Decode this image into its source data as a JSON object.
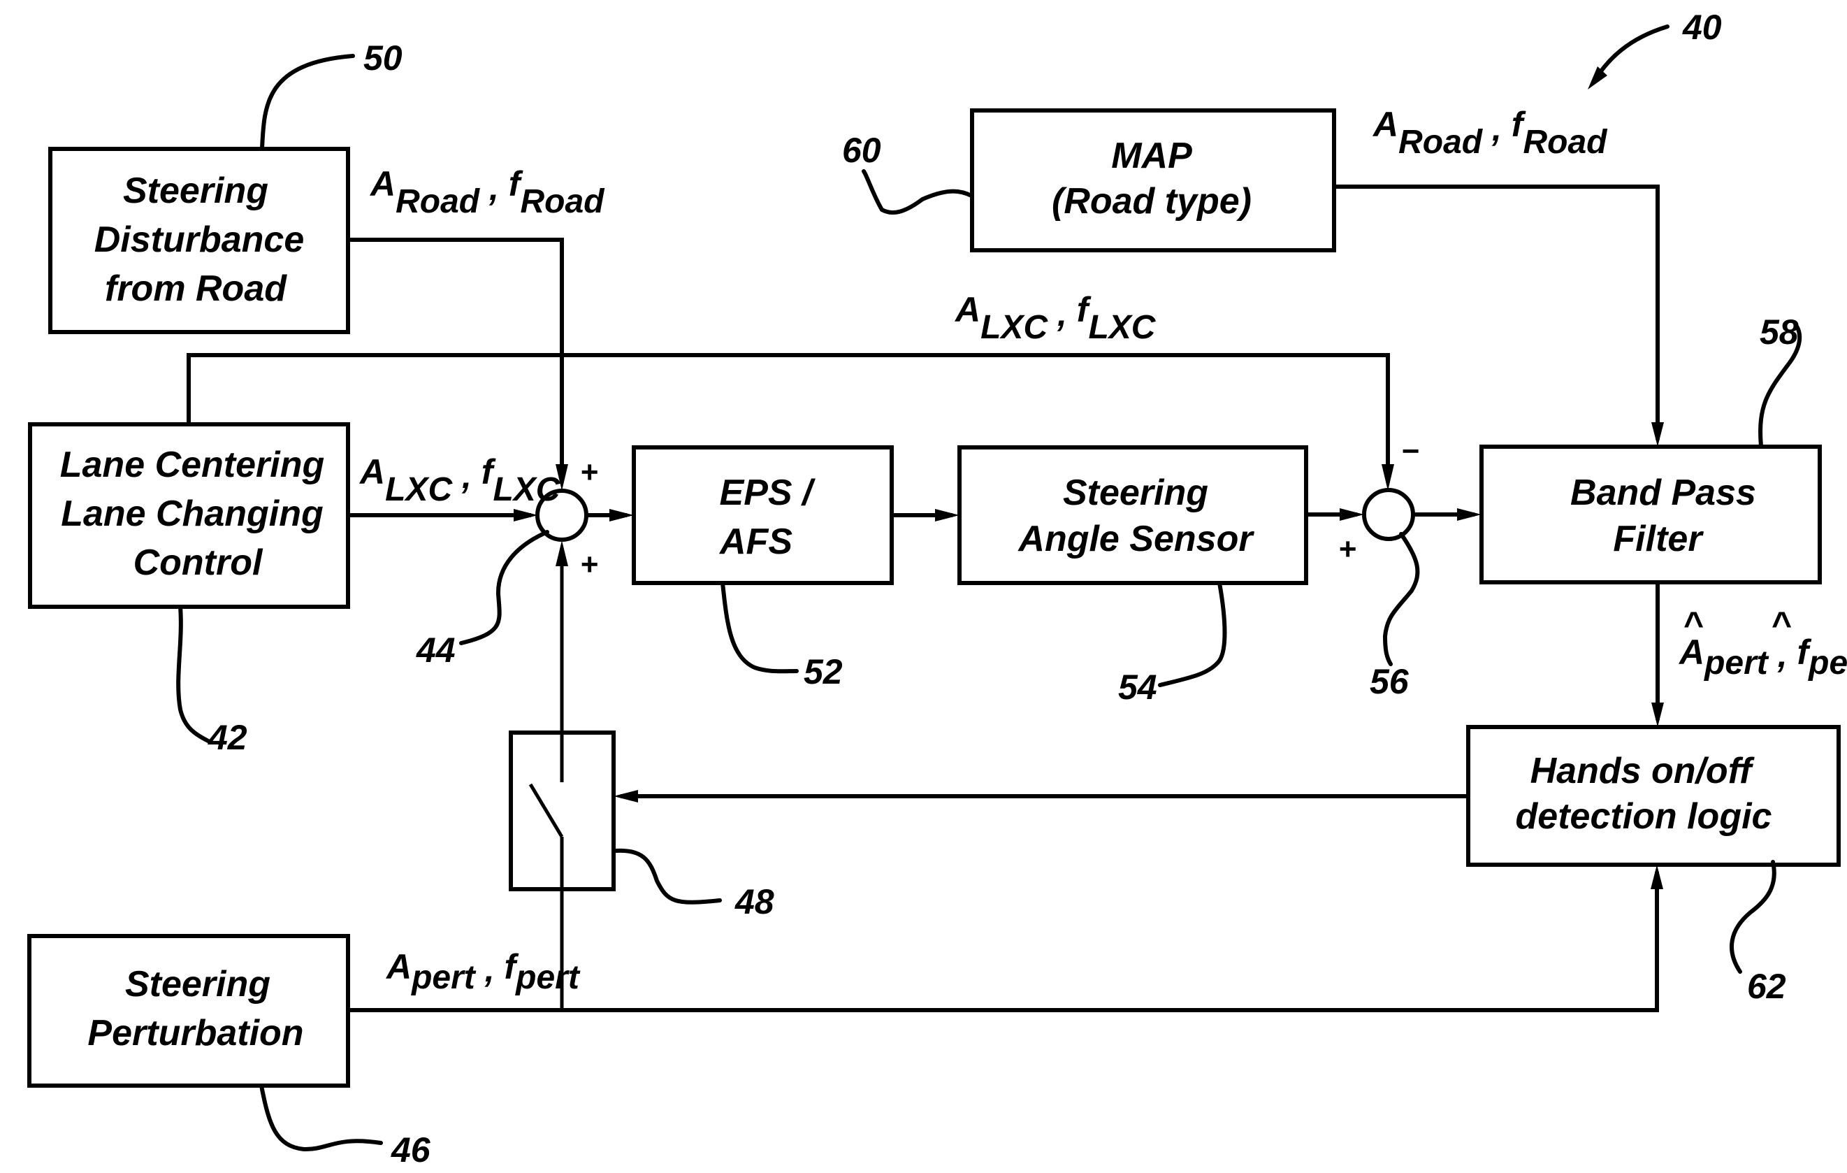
{
  "figure_ref": "40",
  "blocks": {
    "disturbance": {
      "ref": "50",
      "lines": [
        "Steering",
        "Disturbance",
        "from Road"
      ]
    },
    "lane_control": {
      "ref": "42",
      "lines": [
        "Lane Centering",
        "Lane Changing",
        "Control"
      ]
    },
    "perturbation": {
      "ref": "46",
      "lines": [
        "Steering",
        "Perturbation"
      ]
    },
    "eps": {
      "ref": "52",
      "lines": [
        "EPS /",
        "AFS"
      ]
    },
    "angle_sensor": {
      "ref": "54",
      "lines": [
        "Steering",
        "Angle Sensor"
      ]
    },
    "map": {
      "ref": "60",
      "lines": [
        "MAP",
        "(Road type)"
      ]
    },
    "band_pass": {
      "ref": "58",
      "lines": [
        "Band Pass",
        "Filter"
      ]
    },
    "hands_detect": {
      "ref": "62",
      "lines": [
        "Hands on/off",
        "detection logic"
      ]
    },
    "switch": {
      "ref": "48"
    }
  },
  "junctions": {
    "sum1": {
      "ref": "44",
      "top_sign": "+",
      "bottom_sign": "+"
    },
    "sum2": {
      "ref": "56",
      "top_sign": "−",
      "left_sign": "+"
    }
  },
  "signals": {
    "road_disturbance": {
      "a": "A",
      "a_sub": "Road",
      "sep": " , ",
      "f": "f",
      "f_sub": "Road"
    },
    "map_road": {
      "a": "A",
      "a_sub": "Road",
      "sep": " , ",
      "f": "f",
      "f_sub": "Road"
    },
    "lxc_top": {
      "a": "A",
      "a_sub": "LXC",
      "sep": " , ",
      "f": "f",
      "f_sub": "LXC"
    },
    "lxc_main": {
      "a": "A",
      "a_sub": "LXC",
      "sep": " , ",
      "f": "f",
      "f_sub": "LXC"
    },
    "pert": {
      "a": "A",
      "a_sub": "pert",
      "sep": " , ",
      "f": "f",
      "f_sub": "pert"
    },
    "pert_est": {
      "a": "A",
      "a_sub": "pert",
      "sep": " , ",
      "f": "f",
      "f_sub": "pert",
      "hat": "^"
    }
  }
}
